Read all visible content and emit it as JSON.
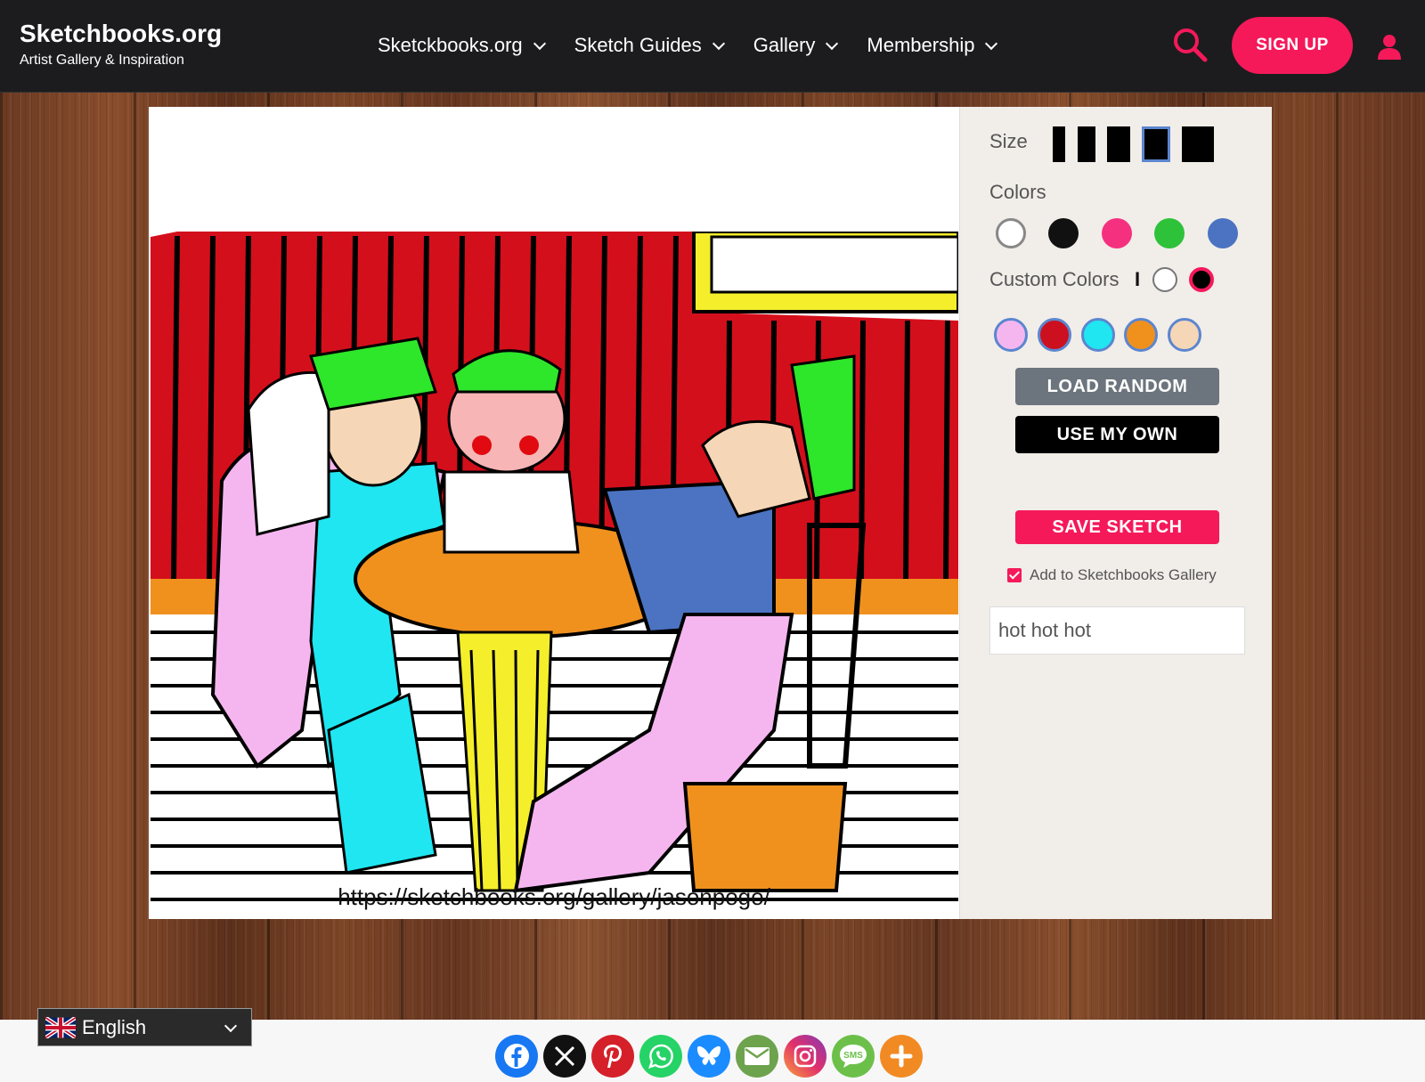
{
  "brand": {
    "title": "Sketchbooks.org",
    "subtitle": "Artist Gallery & Inspiration"
  },
  "nav": [
    {
      "label": "Sketckbooks.org"
    },
    {
      "label": "Sketch Guides"
    },
    {
      "label": "Gallery"
    },
    {
      "label": "Membership"
    }
  ],
  "header": {
    "signup_label": "SIGN UP"
  },
  "canvas": {
    "url": "https://sketchbooks.org/gallery/jasonpogo/"
  },
  "tools": {
    "size_label": "Size",
    "colors_label": "Colors",
    "custom_colors_label": "Custom Colors",
    "custom_separator": "I",
    "colors": [
      "#ffffff",
      "#111111",
      "#f5317f",
      "#2ec23a",
      "#4b73c2"
    ],
    "custom_colors": [
      "#f5b6f0",
      "#cc1020",
      "#1fe6f0",
      "#f0911e",
      "#f5d6b6"
    ],
    "load_random_label": "LOAD RANDOM",
    "use_my_own_label": "USE MY OWN",
    "save_label": "SAVE SKETCH",
    "gallery_checkbox_label": "Add to Sketchbooks Gallery",
    "gallery_checked": true,
    "sketch_name_value": "hot hot hot"
  },
  "language": {
    "selected": "English"
  },
  "share": [
    "facebook",
    "x",
    "pinterest",
    "whatsapp",
    "bluesky",
    "email",
    "instagram",
    "sms",
    "more"
  ],
  "share_labels": {
    "sms": "SMS"
  },
  "accent_color": "#f5195a"
}
